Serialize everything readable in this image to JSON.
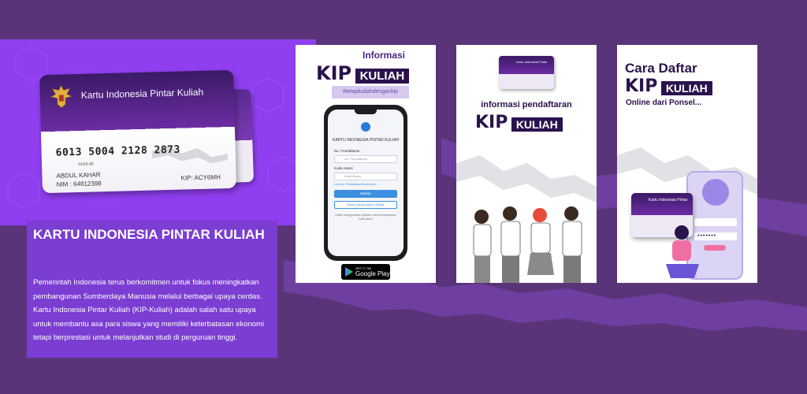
{
  "colors": {
    "background": "#5a3478",
    "hero": "#8f3ff0",
    "info_block": "#7b3dd2",
    "dark_purple": "#2a124d",
    "panel": "#ffffff"
  },
  "hero_card": {
    "title": "Kartu Indonesia Pintar Kuliah",
    "number": "6013 5004 2128 2873",
    "small_text": "01/20  05",
    "holder": "ABDUL KAHAR",
    "nim": "NIM : 64812398",
    "kip": "KIP: ACY6MH"
  },
  "info": {
    "title": "KARTU INDONESIA PINTAR KULIAH",
    "description": "Pemerintah Indonesia terus berkomitmen untuk fokus meningkatkan pembangunan Sumberdaya Manusia melalui berbagai upaya cerdas. Kartu Indonesia Pintar Kuliah (KIP-Kuliah) adalah salah satu upaya untuk membantu asa para siswa yang memiliki keterbatasan ekonomi tetapi berprestasi untuk melanjutkan studi di perguruan tinggi."
  },
  "panel1": {
    "label": "Informasi",
    "kip": "KIP",
    "kuliah": "KULIAH",
    "hashtag": "#tetapkuliahdengankip",
    "app_name": "KARTU INDONESIA PINTAR KULIAH",
    "field1_label": "No. Pendaftaran",
    "field1_placeholder": "No. Pendaftaran",
    "field2_label": "Kode Akses",
    "field2_placeholder": "Kode Akses",
    "forgot": "Lupa No. Pendaftaran/Kode Akses",
    "login_button": "Masuk",
    "register_button": "Belum punya akun? Daftar",
    "note": "Daftar menggunakan aplikasi untuk mendapatkan kode akses",
    "gplay_small": "GET IT ON",
    "gplay_big": "Google Play"
  },
  "panel2": {
    "card_title": "Kartu Indonesia Pintar",
    "subtitle": "informasi pendaftaran",
    "kip": "KIP",
    "kuliah": "KULIAH"
  },
  "panel3": {
    "title": "Cara Daftar",
    "kip": "KIP",
    "kuliah": "KULIAH",
    "subtitle": "Online dari Ponsel...",
    "card_title": "Kartu Indonesia Pintar",
    "password": "•••••••"
  }
}
